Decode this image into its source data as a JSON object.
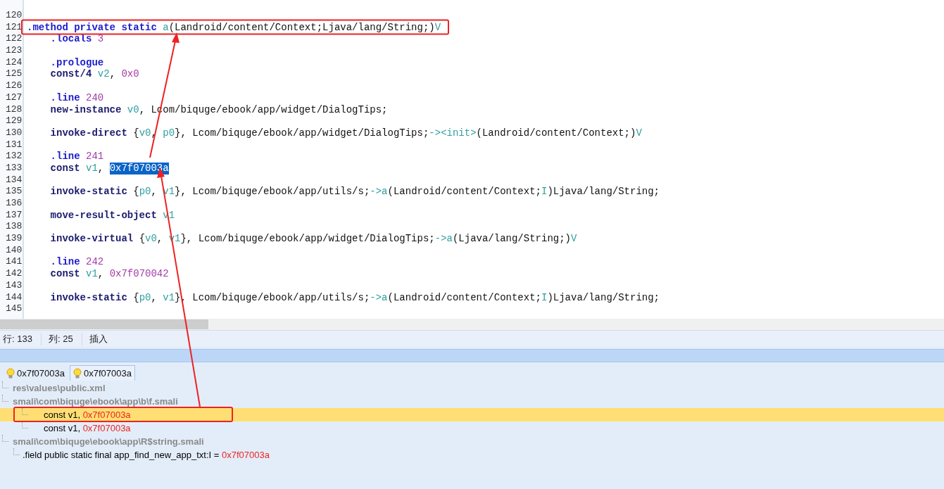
{
  "editor": {
    "lines": [
      {
        "number": "120"
      },
      {
        "number": "121",
        "indented": false,
        "tokens": [
          {
            "kind": "directive",
            "text": ".method private static "
          },
          {
            "kind": "symbol",
            "text": "a"
          },
          {
            "kind": "text",
            "text": "(Landroid/content/Context;Ljava/lang/String;)"
          },
          {
            "kind": "symbol",
            "text": "V"
          }
        ]
      },
      {
        "number": "122",
        "indented": true,
        "tokens": [
          {
            "kind": "directive",
            "text": ".locals "
          },
          {
            "kind": "number",
            "text": "3"
          }
        ]
      },
      {
        "number": "123"
      },
      {
        "number": "124",
        "indented": true,
        "tokens": [
          {
            "kind": "directive",
            "text": ".prologue"
          }
        ]
      },
      {
        "number": "125",
        "indented": true,
        "tokens": [
          {
            "kind": "op",
            "text": "const/4 "
          },
          {
            "kind": "register",
            "text": "v2"
          },
          {
            "kind": "text",
            "text": ", "
          },
          {
            "kind": "number",
            "text": "0x0"
          }
        ]
      },
      {
        "number": "126"
      },
      {
        "number": "127",
        "indented": true,
        "tokens": [
          {
            "kind": "directive",
            "text": ".line "
          },
          {
            "kind": "number",
            "text": "240"
          }
        ]
      },
      {
        "number": "128",
        "indented": true,
        "tokens": [
          {
            "kind": "op",
            "text": "new-instance "
          },
          {
            "kind": "register",
            "text": "v0"
          },
          {
            "kind": "text",
            "text": ", Lcom/biquge/ebook/app/widget/DialogTips;"
          }
        ]
      },
      {
        "number": "129"
      },
      {
        "number": "130",
        "indented": true,
        "tokens": [
          {
            "kind": "op",
            "text": "invoke-direct "
          },
          {
            "kind": "text",
            "text": "{"
          },
          {
            "kind": "register",
            "text": "v0"
          },
          {
            "kind": "text",
            "text": ", "
          },
          {
            "kind": "register",
            "text": "p0"
          },
          {
            "kind": "text",
            "text": "}, Lcom/biquge/ebook/app/widget/DialogTips;"
          },
          {
            "kind": "symbol",
            "text": "-><init>"
          },
          {
            "kind": "text",
            "text": "(Landroid/content/Context;)"
          },
          {
            "kind": "symbol",
            "text": "V"
          }
        ]
      },
      {
        "number": "131"
      },
      {
        "number": "132",
        "indented": true,
        "tokens": [
          {
            "kind": "directive",
            "text": ".line "
          },
          {
            "kind": "number",
            "text": "241"
          }
        ]
      },
      {
        "number": "133",
        "indented": true,
        "tokens": [
          {
            "kind": "op",
            "text": "const "
          },
          {
            "kind": "register",
            "text": "v1"
          },
          {
            "kind": "text",
            "text": ", "
          },
          {
            "kind": "number",
            "text": "0x7f07003a",
            "selected": true
          }
        ]
      },
      {
        "number": "134"
      },
      {
        "number": "135",
        "indented": true,
        "tokens": [
          {
            "kind": "op",
            "text": "invoke-static "
          },
          {
            "kind": "text",
            "text": "{"
          },
          {
            "kind": "register",
            "text": "p0"
          },
          {
            "kind": "text",
            "text": ", "
          },
          {
            "kind": "register",
            "text": "v1"
          },
          {
            "kind": "text",
            "text": "}, Lcom/biquge/ebook/app/utils/s;"
          },
          {
            "kind": "symbol",
            "text": "->a"
          },
          {
            "kind": "text",
            "text": "(Landroid/content/Context;"
          },
          {
            "kind": "symbol",
            "text": "I"
          },
          {
            "kind": "text",
            "text": ")Ljava/lang/String;"
          }
        ]
      },
      {
        "number": "136"
      },
      {
        "number": "137",
        "indented": true,
        "tokens": [
          {
            "kind": "op",
            "text": "move-result-object "
          },
          {
            "kind": "register",
            "text": "v1"
          }
        ]
      },
      {
        "number": "138"
      },
      {
        "number": "139",
        "indented": true,
        "tokens": [
          {
            "kind": "op",
            "text": "invoke-virtual "
          },
          {
            "kind": "text",
            "text": "{"
          },
          {
            "kind": "register",
            "text": "v0"
          },
          {
            "kind": "text",
            "text": ", "
          },
          {
            "kind": "register",
            "text": "v1"
          },
          {
            "kind": "text",
            "text": "}, Lcom/biquge/ebook/app/widget/DialogTips;"
          },
          {
            "kind": "symbol",
            "text": "->a"
          },
          {
            "kind": "text",
            "text": "(Ljava/lang/String;)"
          },
          {
            "kind": "symbol",
            "text": "V"
          }
        ]
      },
      {
        "number": "140"
      },
      {
        "number": "141",
        "indented": true,
        "tokens": [
          {
            "kind": "directive",
            "text": ".line "
          },
          {
            "kind": "number",
            "text": "242"
          }
        ]
      },
      {
        "number": "142",
        "indented": true,
        "tokens": [
          {
            "kind": "op",
            "text": "const "
          },
          {
            "kind": "register",
            "text": "v1"
          },
          {
            "kind": "text",
            "text": ", "
          },
          {
            "kind": "number",
            "text": "0x7f070042"
          }
        ]
      },
      {
        "number": "143"
      },
      {
        "number": "144",
        "indented": true,
        "tokens": [
          {
            "kind": "op",
            "text": "invoke-static "
          },
          {
            "kind": "text",
            "text": "{"
          },
          {
            "kind": "register",
            "text": "p0"
          },
          {
            "kind": "text",
            "text": ", "
          },
          {
            "kind": "register",
            "text": "v1"
          },
          {
            "kind": "text",
            "text": "}, Lcom/biquge/ebook/app/utils/s;"
          },
          {
            "kind": "symbol",
            "text": "->a"
          },
          {
            "kind": "text",
            "text": "(Landroid/content/Context;"
          },
          {
            "kind": "symbol",
            "text": "I"
          },
          {
            "kind": "text",
            "text": ")Ljava/lang/String;"
          }
        ]
      },
      {
        "number": "145"
      }
    ]
  },
  "status_bar": [
    "行: 133",
    "列: 25",
    "插入"
  ],
  "search_panel": {
    "tabs": [
      {
        "label": "0x7f07003a",
        "selected": false
      },
      {
        "label": "0x7f07003a",
        "selected": true
      }
    ],
    "results": [
      {
        "file": "res\\values\\public.xml"
      },
      {
        "file": "smali\\com\\biquge\\ebook\\app\\b\\f.smali",
        "children": [
          {
            "kind": "code",
            "prefix": "const v1, ",
            "value": "0x7f07003a",
            "selected": true
          },
          {
            "kind": "code",
            "prefix": "const v1, ",
            "value": "0x7f07003a",
            "selected": false
          }
        ]
      },
      {
        "file": "smali\\com\\biquge\\ebook\\app\\R$string.smali",
        "children": [
          {
            "kind": "field",
            "prefix": ".field public static final app_find_new_app_txt:I = ",
            "value": "0x7f07003a",
            "selected": false
          }
        ]
      }
    ]
  }
}
